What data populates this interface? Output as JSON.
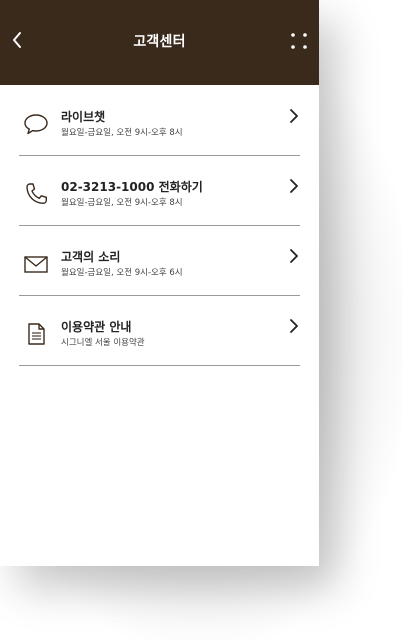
{
  "header": {
    "title": "고객센터"
  },
  "items": [
    {
      "title": "라이브챗",
      "subtitle": "월요일-금요일, 오전 9시-오후 8시",
      "icon": "chat-icon"
    },
    {
      "title": "02-3213-1000 전화하기",
      "subtitle": "월요일-금요일, 오전 9시-오후 8시",
      "icon": "phone-icon"
    },
    {
      "title": "고객의 소리",
      "subtitle": "월요일-금요일, 오전 9시-오후 6시",
      "icon": "mail-icon"
    },
    {
      "title": "이용약관 안내",
      "subtitle": "시그니엘 서울 이용약관",
      "icon": "document-icon"
    }
  ],
  "colors": {
    "header_bg": "#3a2a1c",
    "divider": "#9a9a9a",
    "icon_stroke": "#3a2a1c"
  }
}
